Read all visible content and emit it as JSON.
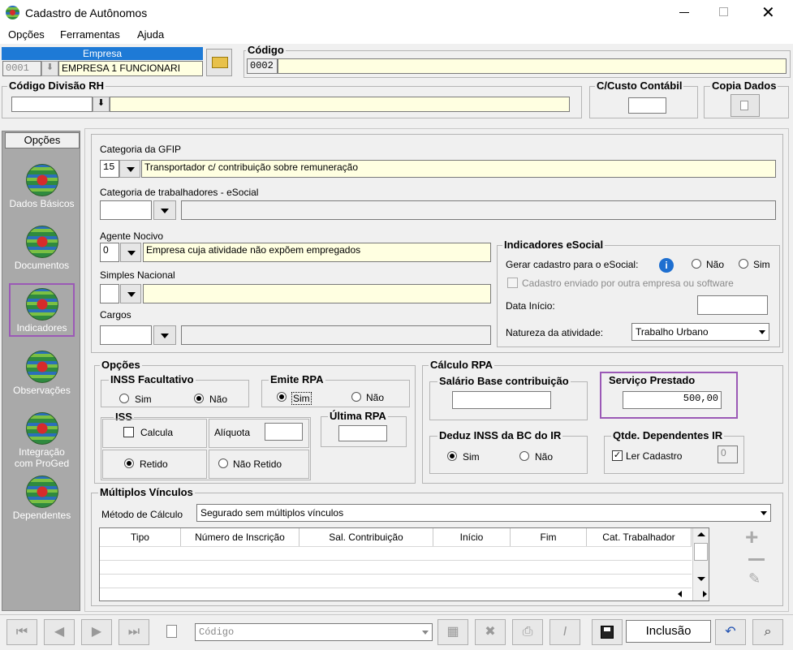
{
  "window": {
    "title": "Cadastro de Autônomos"
  },
  "menu": [
    "Opções",
    "Ferramentas",
    "Ajuda"
  ],
  "empresa": {
    "label": "Empresa",
    "code": "0001",
    "name": "EMPRESA 1 FUNCIONARI"
  },
  "codigo": {
    "label": "Código",
    "value": "0002"
  },
  "divisao": {
    "label": "Código Divisão RH",
    "value": "",
    "desc": ""
  },
  "custo": {
    "label": "C/Custo Contábil",
    "value": ""
  },
  "copia": {
    "label": "Copia Dados"
  },
  "sidebar": {
    "header": "Opções",
    "items": [
      "Dados Básicos",
      "Documentos",
      "Indicadores",
      "Observações",
      "Integração com ProGed",
      "Dependentes"
    ]
  },
  "gfip": {
    "label": "Categoria da GFIP",
    "code": "15",
    "desc": "Transportador c/ contribuição sobre remuneração"
  },
  "esocial_cat": {
    "label": "Categoria de trabalhadores - eSocial",
    "code": "",
    "desc": ""
  },
  "agente": {
    "label": "Agente  Nocivo",
    "code": "0",
    "desc": "Empresa cuja atividade não expõem empregados"
  },
  "simples": {
    "label": "Simples Nacional",
    "code": "",
    "desc": ""
  },
  "cargos": {
    "label": "Cargos",
    "code": "",
    "desc": ""
  },
  "ind_esocial": {
    "title": "Indicadores eSocial",
    "gerar_label": "Gerar cadastro para o eSocial:",
    "nao": "Não",
    "sim": "Sim",
    "enviado_label": "Cadastro enviado por outra empresa ou software",
    "data_label": "Data Início:",
    "natureza_label": "Natureza da atividade:",
    "natureza_value": "Trabalho Urbano"
  },
  "opcoes": {
    "title": "Opções",
    "inss_title": "INSS Facultativo",
    "inss_sim": "Sim",
    "inss_nao": "Não",
    "emite_title": "Emite RPA",
    "emite_sim": "Sim",
    "emite_nao": "Não",
    "iss_title": "ISS",
    "calcula": "Calcula",
    "aliquota": "Alíquota",
    "retido": "Retido",
    "nao_retido": "Não Retido",
    "ultima_title": "Última RPA"
  },
  "calculo": {
    "title": "Cálculo RPA",
    "salario_title": "Salário Base contribuição",
    "servico_title": "Serviço Prestado",
    "servico_value": "500,00",
    "deduz_title": "Deduz INSS da BC do IR",
    "deduz_sim": "Sim",
    "deduz_nao": "Não",
    "dep_title": "Qtde. Dependentes IR",
    "ler_cadastro": "Ler Cadastro",
    "dep_value": "0"
  },
  "multiplos": {
    "title": "Múltiplos Vínculos",
    "metodo_label": "Método de Cálculo",
    "metodo_value": "Segurado sem múltiplos vínculos",
    "columns": [
      "Tipo",
      "Número de Inscrição",
      "Sal. Contribuição",
      "Início",
      "Fim",
      "Cat. Trabalhador"
    ]
  },
  "bottom": {
    "search_placeholder": "Código",
    "status": "Inclusão"
  },
  "colors": {
    "highlight": "#9b59b6",
    "yellow_field": "#ffffe1",
    "sidebar": "#a9a9a9",
    "header_blue": "#1e7ad6"
  }
}
